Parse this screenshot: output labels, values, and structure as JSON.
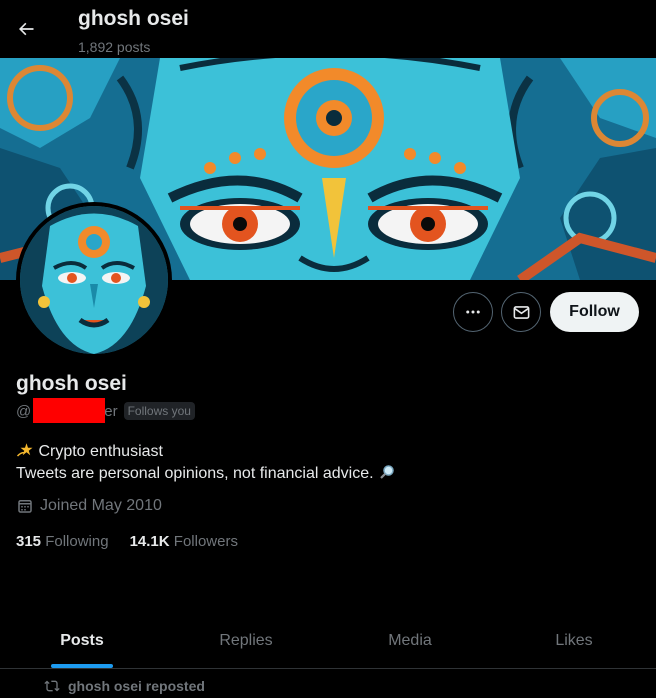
{
  "header": {
    "title": "ghosh osei",
    "post_count": "1,892 posts"
  },
  "profile": {
    "name": "ghosh osei",
    "handle_prefix": "@",
    "handle_suffix": "er",
    "follows_you": "Follows you",
    "bio_line1": "Crypto enthusiast",
    "bio_line2": "Tweets are personal opinions, not financial advice.",
    "joined": "Joined May 2010",
    "following_count": "315",
    "following_label": "Following",
    "followers_count": "14.1K",
    "followers_label": "Followers"
  },
  "actions": {
    "follow_label": "Follow",
    "more_icon": "more-dots-icon",
    "message_icon": "envelope-icon"
  },
  "tabs": [
    {
      "label": "Posts",
      "active": true
    },
    {
      "label": "Replies",
      "active": false
    },
    {
      "label": "Media",
      "active": false
    },
    {
      "label": "Likes",
      "active": false
    }
  ],
  "feed": {
    "repost_text": "ghosh osei reposted"
  },
  "colors": {
    "background": "#000000",
    "accent": "#1d9bf0",
    "muted_text": "#71767b",
    "follow_button_bg": "#eff3f4"
  }
}
